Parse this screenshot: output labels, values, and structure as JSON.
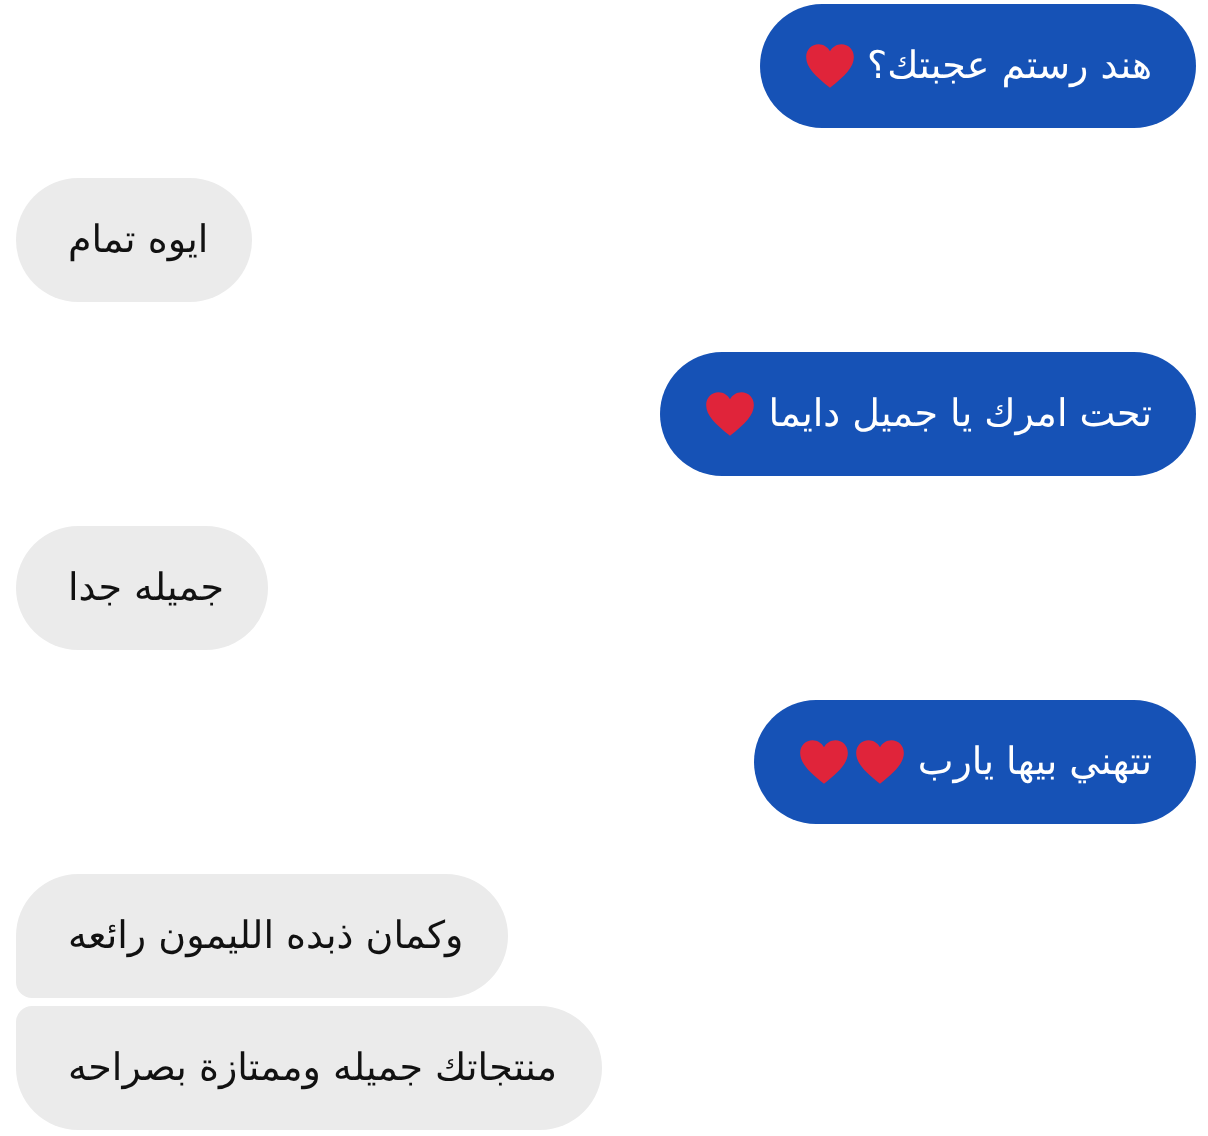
{
  "messages": [
    {
      "kind": "outgoing",
      "grouped": false,
      "parts": [
        {
          "kind": "text",
          "text": "هند رستم عجبتك؟"
        },
        {
          "kind": "heart"
        }
      ]
    },
    {
      "kind": "incoming",
      "grouped": false,
      "parts": [
        {
          "kind": "text",
          "text": "ايوه تمام"
        }
      ]
    },
    {
      "kind": "outgoing",
      "grouped": false,
      "parts": [
        {
          "kind": "text",
          "text": "تحت امرك يا جميل دايما"
        },
        {
          "kind": "heart"
        }
      ]
    },
    {
      "kind": "incoming",
      "grouped": false,
      "parts": [
        {
          "kind": "text",
          "text": "جميله جدا"
        }
      ]
    },
    {
      "kind": "outgoing",
      "grouped": false,
      "parts": [
        {
          "kind": "text",
          "text": "تتهني بيها يارب"
        },
        {
          "kind": "heart"
        },
        {
          "kind": "heart"
        }
      ]
    },
    {
      "kind": "incoming",
      "grouped": false,
      "parts": [
        {
          "kind": "text",
          "text": "وكمان ذبده الليمون رائعه"
        }
      ]
    },
    {
      "kind": "incoming",
      "grouped": true,
      "parts": [
        {
          "kind": "text",
          "text": "منتجاتك جميله وممتازة بصراحه"
        }
      ]
    }
  ]
}
